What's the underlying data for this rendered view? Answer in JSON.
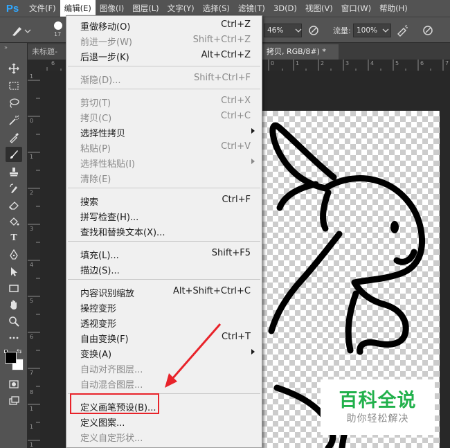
{
  "app": {
    "logo": "Ps"
  },
  "menubar": {
    "items": [
      "文件(F)",
      "编辑(E)",
      "图像(I)",
      "图层(L)",
      "文字(Y)",
      "选择(S)",
      "滤镜(T)",
      "3D(D)",
      "视图(V)",
      "窗口(W)",
      "帮助(H)"
    ],
    "active_index": 1
  },
  "options": {
    "brush_size": "17",
    "opacity_value": "46%",
    "flow_label": "流量:",
    "flow_value": "100%"
  },
  "tabs": {
    "left_label": "未标题-",
    "current_label": "拷贝, RGB/8#) *",
    "close_symbol": "×"
  },
  "ruler": {
    "top_labels": [
      "6",
      "0",
      "1",
      "2",
      "3",
      "4",
      "5",
      "6",
      "7",
      "8"
    ],
    "left_labels": [
      "1",
      "0",
      "1",
      "2",
      "3",
      "4",
      "5",
      "6",
      "7",
      "8",
      "1",
      "1",
      "1"
    ]
  },
  "edit_menu": {
    "items": [
      {
        "label": "重做移动(O)",
        "shortcut": "Ctrl+Z",
        "disabled": false
      },
      {
        "label": "前进一步(W)",
        "shortcut": "Shift+Ctrl+Z",
        "disabled": true
      },
      {
        "label": "后退一步(K)",
        "shortcut": "Alt+Ctrl+Z",
        "disabled": false
      },
      {
        "label": "渐隐(D)...",
        "shortcut": "Shift+Ctrl+F",
        "disabled": true
      },
      {
        "label": "剪切(T)",
        "shortcut": "Ctrl+X",
        "disabled": true
      },
      {
        "label": "拷贝(C)",
        "shortcut": "Ctrl+C",
        "disabled": true
      },
      {
        "label": "选择性拷贝",
        "shortcut": "",
        "disabled": false,
        "submenu": true
      },
      {
        "label": "粘贴(P)",
        "shortcut": "Ctrl+V",
        "disabled": true
      },
      {
        "label": "选择性粘贴(I)",
        "shortcut": "",
        "disabled": true,
        "submenu": true
      },
      {
        "label": "清除(E)",
        "shortcut": "",
        "disabled": true
      },
      {
        "label": "搜索",
        "shortcut": "Ctrl+F",
        "disabled": false
      },
      {
        "label": "拼写检查(H)...",
        "shortcut": "",
        "disabled": false
      },
      {
        "label": "查找和替换文本(X)...",
        "shortcut": "",
        "disabled": false
      },
      {
        "label": "填充(L)...",
        "shortcut": "Shift+F5",
        "disabled": false
      },
      {
        "label": "描边(S)...",
        "shortcut": "",
        "disabled": false
      },
      {
        "label": "内容识别缩放",
        "shortcut": "Alt+Shift+Ctrl+C",
        "disabled": false
      },
      {
        "label": "操控变形",
        "shortcut": "",
        "disabled": false
      },
      {
        "label": "透视变形",
        "shortcut": "",
        "disabled": false
      },
      {
        "label": "自由变换(F)",
        "shortcut": "Ctrl+T",
        "disabled": false
      },
      {
        "label": "变换(A)",
        "shortcut": "",
        "disabled": false,
        "submenu": true
      },
      {
        "label": "自动对齐图层...",
        "shortcut": "",
        "disabled": true
      },
      {
        "label": "自动混合图层...",
        "shortcut": "",
        "disabled": true
      },
      {
        "label": "定义画笔预设(B)...",
        "shortcut": "",
        "disabled": false,
        "highlighted": true
      },
      {
        "label": "定义图案...",
        "shortcut": "",
        "disabled": false
      },
      {
        "label": "定义自定形状...",
        "shortcut": "",
        "disabled": true
      }
    ]
  },
  "watermark": {
    "title": "百科全说",
    "subtitle": "助你轻松解决"
  },
  "colors": {
    "highlight": "#e8232a",
    "watermark_green": "#22b14c",
    "ps_blue": "#31a8ff"
  }
}
